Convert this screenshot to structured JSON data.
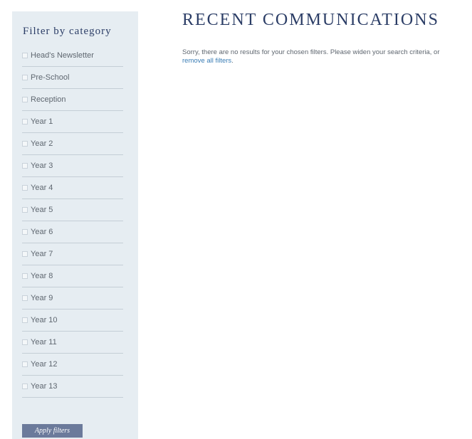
{
  "sidebar": {
    "title": "Filter by category",
    "items": [
      {
        "label": "Head's Newsletter"
      },
      {
        "label": "Pre-School"
      },
      {
        "label": "Reception"
      },
      {
        "label": "Year 1"
      },
      {
        "label": "Year 2"
      },
      {
        "label": "Year 3"
      },
      {
        "label": "Year 4"
      },
      {
        "label": "Year 5"
      },
      {
        "label": "Year 6"
      },
      {
        "label": "Year 7"
      },
      {
        "label": "Year 8"
      },
      {
        "label": "Year 9"
      },
      {
        "label": "Year 10"
      },
      {
        "label": "Year 11"
      },
      {
        "label": "Year 12"
      },
      {
        "label": "Year 13"
      }
    ],
    "apply_label": "Apply filters"
  },
  "main": {
    "title": "RECENT COMMUNICATIONS",
    "message": "Sorry, there are no results for your chosen filters. Please widen your search criteria, or",
    "link_text": "remove all filters",
    "message_end": "."
  },
  "colors": {
    "sidebar_bg": "#e6edf2",
    "heading": "#2b3d66",
    "link": "#3a7db5",
    "button": "#6b7a9b"
  }
}
